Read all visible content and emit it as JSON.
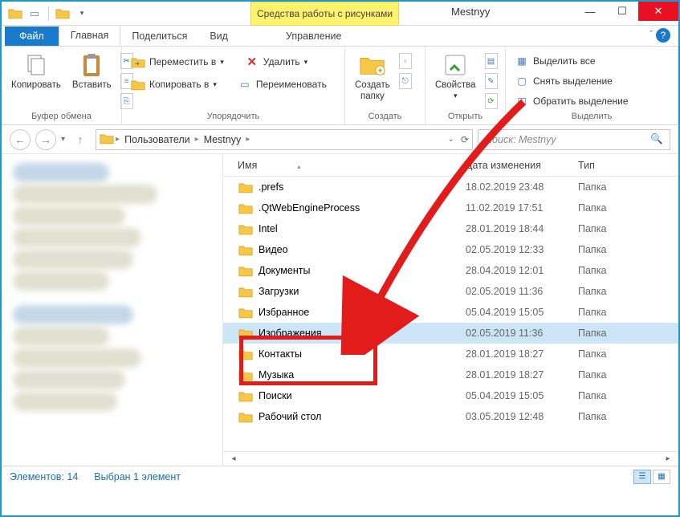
{
  "window": {
    "tool_context": "Средства работы с рисунками",
    "title": "Mestnyy"
  },
  "tabs": {
    "file": "Файл",
    "home": "Главная",
    "share": "Поделиться",
    "view": "Вид",
    "manage": "Управление"
  },
  "ribbon": {
    "clipboard": {
      "copy": "Копировать",
      "paste": "Вставить",
      "label": "Буфер обмена"
    },
    "organize": {
      "moveto": "Переместить в",
      "copyto": "Копировать в",
      "delete": "Удалить",
      "rename": "Переименовать",
      "label": "Упорядочить"
    },
    "new": {
      "newfolder_l1": "Создать",
      "newfolder_l2": "папку",
      "label": "Создать"
    },
    "open": {
      "props": "Свойства",
      "label": "Открыть"
    },
    "select": {
      "all": "Выделить все",
      "none": "Снять выделение",
      "invert": "Обратить выделение",
      "label": "Выделить"
    }
  },
  "breadcrumb": {
    "users": "Пользователи",
    "folder": "Mestnyy"
  },
  "search": {
    "placeholder": "Поиск: Mestnyy"
  },
  "columns": {
    "name": "Имя",
    "date": "Дата изменения",
    "type": "Тип"
  },
  "type_folder": "Папка",
  "rows": [
    {
      "name": ".prefs",
      "date": "18.02.2019 23:48"
    },
    {
      "name": ".QtWebEngineProcess",
      "date": "11.02.2019 17:51"
    },
    {
      "name": "Intel",
      "date": "28.01.2019 18:44"
    },
    {
      "name": "Видео",
      "date": "02.05.2019 12:33"
    },
    {
      "name": "Документы",
      "date": "28.04.2019 12:01"
    },
    {
      "name": "Загрузки",
      "date": "02.05.2019 11:36"
    },
    {
      "name": "Избранное",
      "date": "05.04.2019 15:05"
    },
    {
      "name": "Изображения",
      "date": "02.05.2019 11:36",
      "selected": true
    },
    {
      "name": "Контакты",
      "date": "28.01.2019 18:27"
    },
    {
      "name": "Музыка",
      "date": "28.01.2019 18:27"
    },
    {
      "name": "Поиски",
      "date": "05.04.2019 15:05"
    },
    {
      "name": "Рабочий стол",
      "date": "03.05.2019 12:48"
    }
  ],
  "status": {
    "items": "Элементов: 14",
    "selected": "Выбран 1 элемент"
  }
}
